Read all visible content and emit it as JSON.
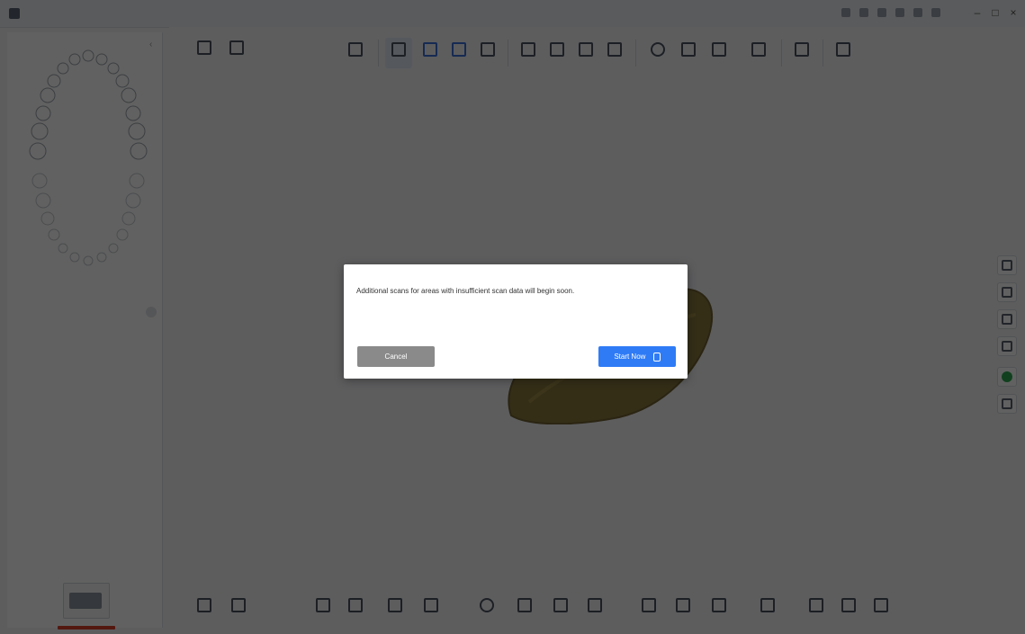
{
  "window": {
    "title": "",
    "controls": [
      "minimize-icon",
      "maximize-icon",
      "close-icon"
    ]
  },
  "left_panel": {
    "step_title": "",
    "step_instructions": "",
    "collapse_icon": "chevron-left-icon"
  },
  "toolbar": {
    "groups": [
      {
        "id": "left",
        "buttons": [
          {
            "label": ""
          },
          {
            "label": ""
          }
        ]
      },
      {
        "id": "center",
        "buttons": [
          {
            "label": "",
            "icon": "info-icon"
          },
          {
            "label": "",
            "icon": "scan-mode-icon",
            "active": true
          },
          {
            "label": "",
            "icon": "upper-jaw-icon"
          },
          {
            "label": "",
            "icon": "lower-jaw-icon"
          },
          {
            "label": "",
            "icon": "bite-icon"
          },
          {
            "label": "",
            "icon": "upper-icon"
          },
          {
            "label": "",
            "icon": "lower-icon"
          },
          {
            "label": "",
            "icon": "preparation-icon"
          },
          {
            "label": "",
            "icon": "model-icon"
          },
          {
            "label": "",
            "icon": "tooth-icon"
          },
          {
            "label": "",
            "icon": "trim-icon"
          },
          {
            "label": "",
            "icon": "fill-icon"
          },
          {
            "label": "",
            "icon": "list-icon"
          },
          {
            "label": "",
            "icon": "filter-icon"
          },
          {
            "label": "",
            "icon": "ai-icon"
          }
        ]
      }
    ]
  },
  "bottom_toolbar": {
    "buttons": [
      "undo-icon",
      "redo-icon",
      "crop-icon",
      "select-icon",
      "lasso-icon",
      "brush-icon",
      "reset-view-icon",
      "camera-icon",
      "compare-icon",
      "color-icon",
      "texture-icon",
      "mesh-icon",
      "align-icon",
      "gallery-icon",
      "measure-icon",
      "section-icon",
      "ruler-icon"
    ]
  },
  "side_tools": [
    "fit-icon",
    "zoom-in-icon",
    "zoom-out-icon",
    "search-icon",
    "color-toggle-icon",
    "layers-icon"
  ],
  "dialog": {
    "message": "Additional scans for areas with insufficient scan data will begin soon.",
    "cancel_label": "Cancel",
    "start_label": "Start Now"
  },
  "colors": {
    "primary_button": "#2f7bf6",
    "secondary_button": "#8a8a8a",
    "overlay": "rgba(0,0,0,0.62)",
    "model_surface": "#8a7a3e",
    "status_green": "#2fa84f",
    "scan_progress_bar": "#d9412b"
  }
}
